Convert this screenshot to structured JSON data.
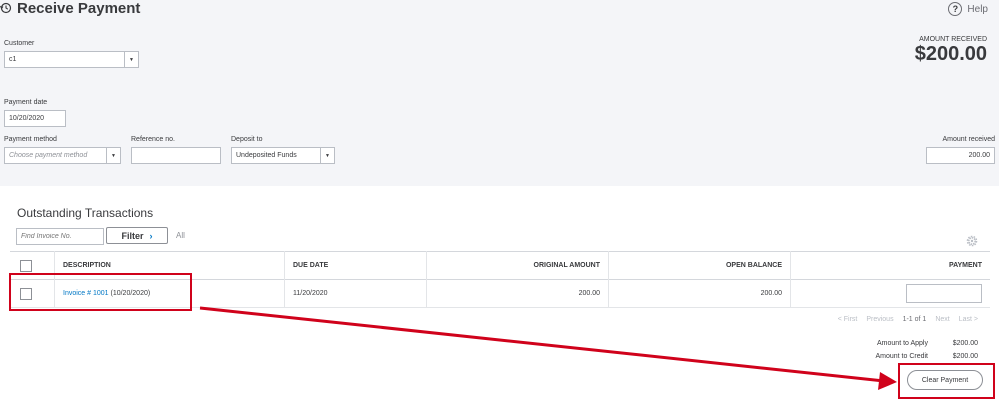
{
  "header": {
    "title": "Receive Payment",
    "help_label": "Help",
    "help_symbol": "?"
  },
  "form": {
    "customer": {
      "label": "Customer",
      "value": "c1"
    },
    "amount_received_header": {
      "label": "AMOUNT RECEIVED",
      "value": "$200.00"
    },
    "payment_date": {
      "label": "Payment date",
      "value": "10/20/2020"
    },
    "payment_method": {
      "label": "Payment method",
      "placeholder": "Choose payment method"
    },
    "reference_no": {
      "label": "Reference no.",
      "value": ""
    },
    "deposit_to": {
      "label": "Deposit to",
      "value": "Undeposited Funds"
    },
    "amount_received": {
      "label": "Amount received",
      "value": "200.00"
    }
  },
  "transactions": {
    "title": "Outstanding Transactions",
    "find_placeholder": "Find Invoice No.",
    "filter_label": "Filter",
    "all_label": "All",
    "columns": [
      "DESCRIPTION",
      "DUE DATE",
      "ORIGINAL AMOUNT",
      "OPEN BALANCE",
      "PAYMENT"
    ],
    "rows": [
      {
        "invoice_link": "Invoice # 1001",
        "invoice_date": "(10/20/2020)",
        "due_date": "11/20/2020",
        "original_amount": "200.00",
        "open_balance": "200.00",
        "payment": ""
      }
    ],
    "pager": {
      "first": "< First",
      "previous": "Previous",
      "range": "1-1 of 1",
      "next": "Next",
      "last": "Last >"
    }
  },
  "summary": {
    "amount_to_apply_label": "Amount to Apply",
    "amount_to_apply": "$200.00",
    "amount_to_credit_label": "Amount to Credit",
    "amount_to_credit": "$200.00"
  },
  "actions": {
    "clear_payment": "Clear Payment"
  },
  "colors": {
    "annotation": "#d0021b",
    "link": "#0077c5",
    "header_bg": "#f4f5f8"
  }
}
